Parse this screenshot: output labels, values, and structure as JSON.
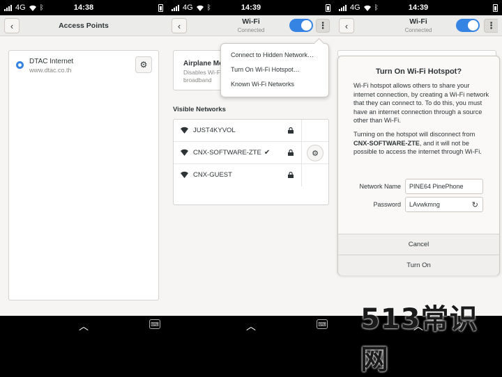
{
  "screens": [
    {
      "status": {
        "network": "4G",
        "time": "14:38"
      },
      "header": {
        "title": "Access Points"
      },
      "access_points": [
        {
          "name": "DTAC Internet",
          "apn": "www.dtac.co.th"
        }
      ]
    },
    {
      "status": {
        "network": "4G",
        "time": "14:39"
      },
      "header": {
        "title": "Wi-Fi",
        "subtitle": "Connected"
      },
      "airplane": {
        "title": "Airplane Mo",
        "desc": "Disables Wi-Fi broadband"
      },
      "menu": [
        "Connect to Hidden Network…",
        "Turn On Wi-Fi Hotspot…",
        "Known Wi-Fi Networks"
      ],
      "section_title": "Visible Networks",
      "networks": [
        {
          "name": "JUST4KYVOL",
          "connected": ""
        },
        {
          "name": "CNX-SOFTWARE-ZTE",
          "connected": "✔"
        },
        {
          "name": "CNX-GUEST",
          "connected": ""
        }
      ]
    },
    {
      "status": {
        "network": "4G",
        "time": "14:39"
      },
      "header": {
        "title": "Wi-Fi",
        "subtitle": "Connected"
      },
      "dialog": {
        "title": "Turn On Wi-Fi Hotspot?",
        "p1": "Wi-Fi hotspot allows others to share your internet connection, by creating a Wi-Fi network that they can connect to. To do this, you must have an internet connection through a source other than Wi-Fi.",
        "p2_pre": "Turning on the hotspot will disconnect from ",
        "p2_bold": "CNX-SOFTWARE-ZTE",
        "p2_post": ", and it will not be possible to access the internet through Wi-Fi.",
        "network_name_label": "Network Name",
        "network_name_value": "PINE64 PinePhone",
        "password_label": "Password",
        "password_value": "LAvwkmng",
        "cancel_label": "Cancel",
        "turn_on_label": "Turn On"
      }
    }
  ],
  "watermark": "513常识网",
  "colors": {
    "accent": "#3584e4",
    "header_bg": "#ebebea",
    "window_bg": "#f6f5f4"
  }
}
